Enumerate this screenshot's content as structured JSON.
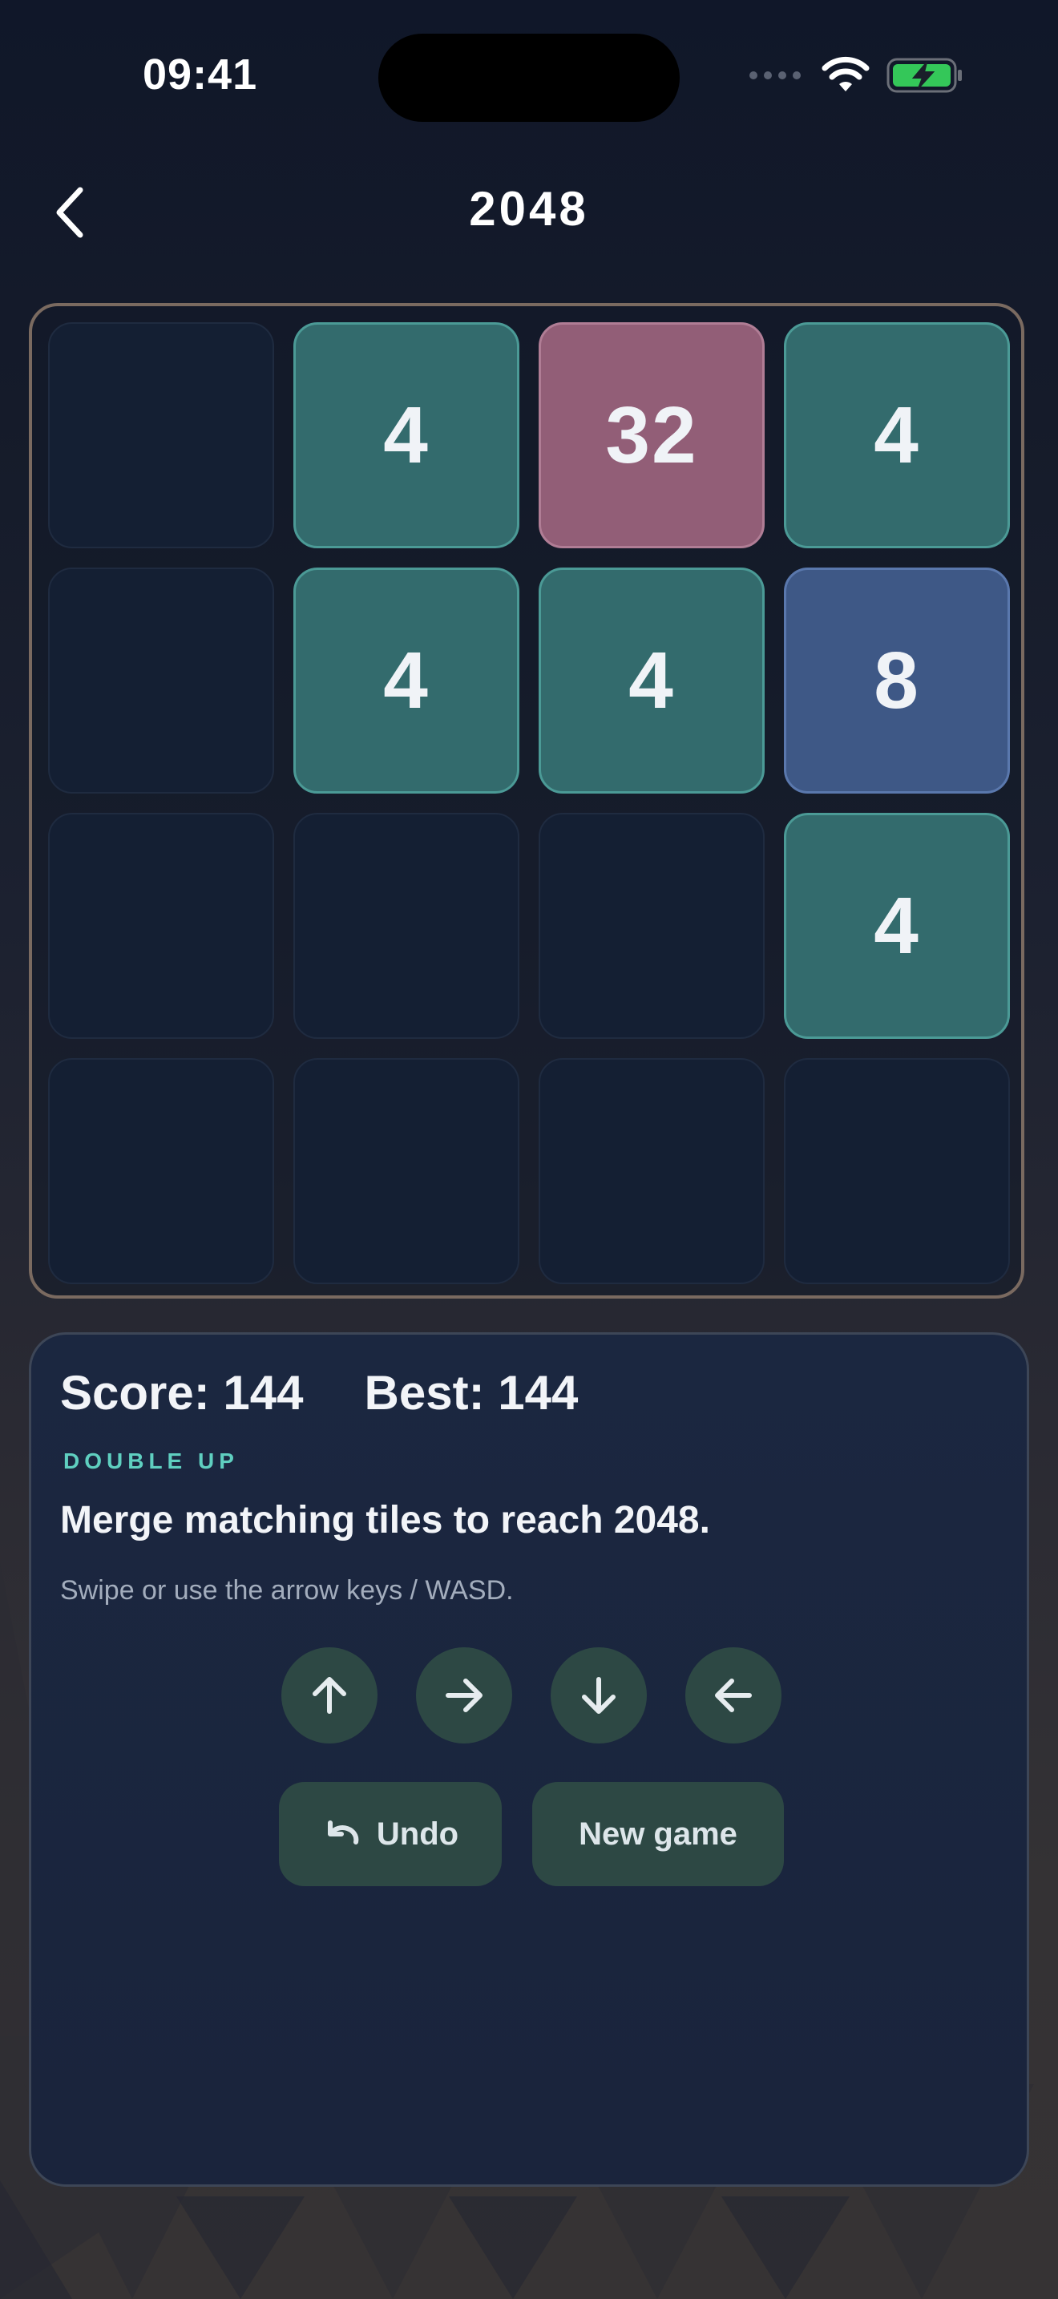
{
  "status_bar": {
    "time": "09:41",
    "icons": [
      "signal-dots-icon",
      "wifi-icon",
      "battery-charging-icon"
    ],
    "battery_color": "#34c759"
  },
  "header": {
    "back_icon": "chevron-left-icon",
    "title": "2048"
  },
  "board": {
    "size": 4,
    "tiles": [
      [
        "",
        "4",
        "32",
        "4"
      ],
      [
        "",
        "4",
        "4",
        "8"
      ],
      [
        "",
        "",
        "",
        "4"
      ],
      [
        "",
        "",
        "",
        ""
      ]
    ],
    "colors": {
      "4": "#336b6d",
      "8": "#3e5886",
      "32": "#925e77",
      "empty": "#141f33",
      "frame": "#7a6a60"
    }
  },
  "panel": {
    "score_label": "Score: 144",
    "best_label": "Best: 144",
    "eyebrow": "DOUBLE UP",
    "headline": "Merge matching tiles to reach 2048.",
    "hint": "Swipe or use the arrow keys / WASD.",
    "arrow_buttons": [
      "arrow-up-icon",
      "arrow-right-icon",
      "arrow-down-icon",
      "arrow-left-icon"
    ],
    "undo_label": "Undo",
    "undo_icon": "undo-icon",
    "new_game_label": "New game",
    "accent": "#5fcfc0",
    "button_color": "#2d4844"
  }
}
